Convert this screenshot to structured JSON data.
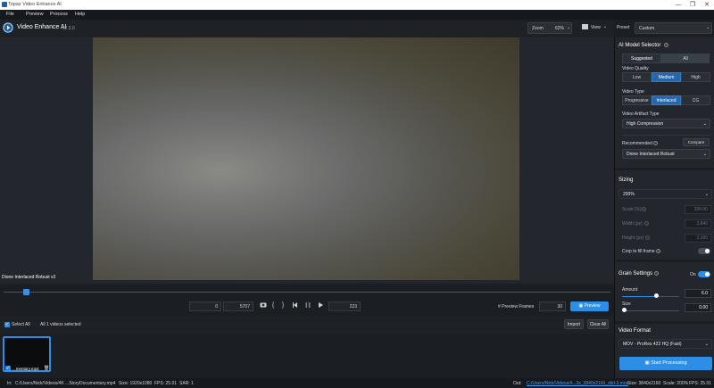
{
  "window": {
    "title": "Topaz Video Enhance AI",
    "minimize": "—",
    "maximize": "❐",
    "close": "✕"
  },
  "menu": [
    "File",
    "Preview",
    "Process",
    "Help"
  ],
  "header": {
    "app_name": "Video Enhance AI",
    "version": "v2.3.0",
    "zoom_label": "Zoom",
    "zoom_value": "62%",
    "view_label": "View",
    "preset_label": "Preset",
    "preset_value": "Custom"
  },
  "preview": {
    "model_caption": "Dione Interlaced Robust v3"
  },
  "controls": {
    "start_frame": "0",
    "end_frame": "5707",
    "current_frame": "223",
    "preview_frames_label": "# Preview Frames",
    "preview_frames_value": "30",
    "preview_button": "Preview",
    "playhead_position": 0.035
  },
  "selection": {
    "select_all": "Select All",
    "count_text": "All 1 videos selected",
    "import": "Import",
    "clear_all": "Clear All"
  },
  "files": [
    {
      "name": "...mentary.mp4"
    }
  ],
  "status": {
    "in_label": "In:",
    "in_path": "C:/Users/Nick/Videos/4K ...Story",
    "in_file": "Documentary.mp4",
    "in_size": "Size: 1920x1080",
    "in_fps": "FPS: 25.01",
    "in_sar": "SAR: 1",
    "out_label": "Out:",
    "out_path": "C:/Users/Nick/Videos/4...3x_3840x2160_diirl-3.mov",
    "out_size": "Size: 3840x2160",
    "out_scale": "Scale: 200%",
    "out_fps": "FPS: 25.01"
  },
  "right_panel": {
    "ai_model_selector": "AI Model Selector",
    "tabs": [
      "Suggested",
      "All"
    ],
    "video_quality_label": "Video Quality",
    "video_quality_options": [
      "Low",
      "Medium",
      "High"
    ],
    "video_quality_selected": "Medium",
    "video_type_label": "Video Type",
    "video_type_options": [
      "Progressive",
      "Interlaced",
      "CG"
    ],
    "video_type_selected": "Interlaced",
    "artifact_label": "Video Artifact Type",
    "artifact_value": "High Compression",
    "recommended_label": "Recommended",
    "compare_button": "Compare",
    "recommended_value": "Dione Interlaced Robust",
    "sizing_title": "Sizing",
    "sizing_value": "200%",
    "scale_label": "Scale (%)",
    "scale_value": "200.00",
    "width_label": "Width (px)",
    "width_value": "3,840",
    "height_label": "Height (px)",
    "height_value": "2,160",
    "crop_label": "Crop to fill frame",
    "grain_title": "Grain Settings",
    "grain_toggle_label": "On",
    "amount_label": "Amount",
    "amount_value": "6.0",
    "amount_level": 0.6,
    "size_label": "Size",
    "size_value": "0.00",
    "size_level": 0.0,
    "video_format_title": "Video Format",
    "video_format_value": "MOV - ProRes 422 HQ (Fast)",
    "start_button": "Start Processing"
  },
  "colors": {
    "accent": "#2d8ee6",
    "panel": "#23272d",
    "background": "#1b1e23"
  }
}
